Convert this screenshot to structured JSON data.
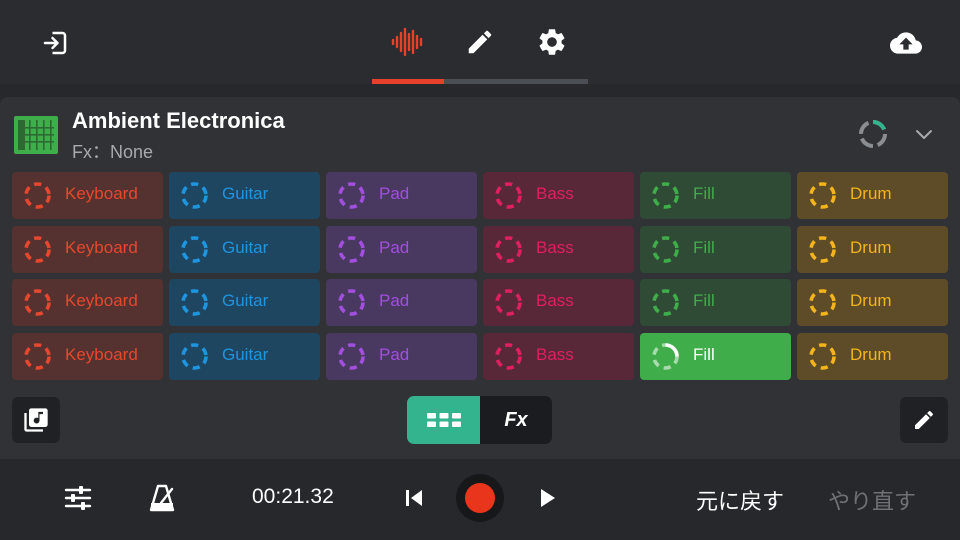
{
  "toolbar": {
    "exit_icon": "exit-icon",
    "tabs": [
      {
        "icon": "waveform-icon",
        "active": true
      },
      {
        "icon": "pencil-icon",
        "active": false
      },
      {
        "icon": "gear-icon",
        "active": false
      }
    ],
    "upload_icon": "cloud-upload-icon",
    "accent": "#e8412a"
  },
  "project": {
    "title": "Ambient Electronica",
    "fx": "Fx：None",
    "icon_color": "#3fae4a"
  },
  "pad_colors": {
    "Keyboard": {
      "fg": "#e8472f",
      "bg": "#55322f"
    },
    "Guitar": {
      "fg": "#1f95e0",
      "bg": "#1f4660"
    },
    "Pad": {
      "fg": "#a24fe0",
      "bg": "#493860"
    },
    "Bass": {
      "fg": "#e01f60",
      "bg": "#582838"
    },
    "Fill": {
      "fg": "#3fae4a",
      "bg": "#2f4a35"
    },
    "Drum": {
      "fg": "#f3b41c",
      "bg": "#5d4c27"
    }
  },
  "pads": [
    [
      "Keyboard",
      "Guitar",
      "Pad",
      "Bass",
      "Fill",
      "Drum"
    ],
    [
      "Keyboard",
      "Guitar",
      "Pad",
      "Bass",
      "Fill",
      "Drum"
    ],
    [
      "Keyboard",
      "Guitar",
      "Pad",
      "Bass",
      "Fill",
      "Drum"
    ],
    [
      "Keyboard",
      "Guitar",
      "Pad",
      "Bass",
      "Fill",
      "Drum"
    ]
  ],
  "active_pad": {
    "row": 3,
    "col": 4,
    "bg": "#3fae4a"
  },
  "mode_toggle": {
    "pads_icon": "grid-icon",
    "fx_label": "Fx",
    "active": "pads",
    "active_color": "#33b48e"
  },
  "transport": {
    "time": "00:21.32",
    "undo": "元に戻す",
    "redo": "やり直す",
    "record_color": "#e8351c"
  }
}
